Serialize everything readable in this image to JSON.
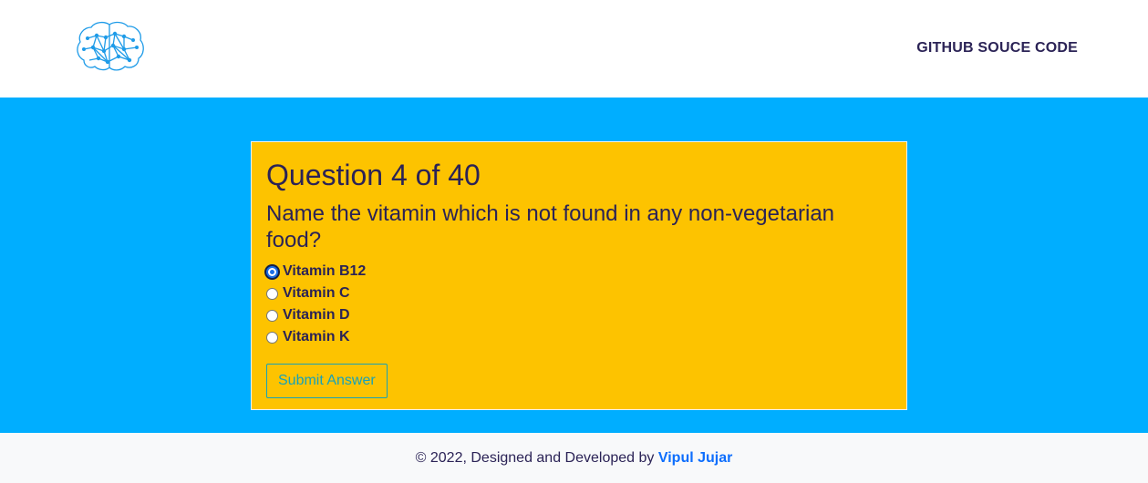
{
  "header": {
    "logo_icon": "brain-network-icon",
    "nav_link": "GITHUB SOUCE CODE"
  },
  "quiz": {
    "question_count": "Question 4 of 40",
    "question_text": "Name the vitamin which is not found in any non-vegetarian food?",
    "options": [
      {
        "label": "Vitamin B12",
        "selected": true
      },
      {
        "label": "Vitamin C",
        "selected": false
      },
      {
        "label": "Vitamin D",
        "selected": false
      },
      {
        "label": "Vitamin K",
        "selected": false
      }
    ],
    "submit_label": "Submit Answer"
  },
  "footer": {
    "copyright_text": "© 2022, Designed and Developed by",
    "author_name": "Vipul Jujar"
  },
  "colors": {
    "main_background": "#00aeff",
    "card_background": "#fdc300",
    "text": "#2b2356",
    "button_accent": "#17a2b8",
    "link": "#0d6efd"
  }
}
